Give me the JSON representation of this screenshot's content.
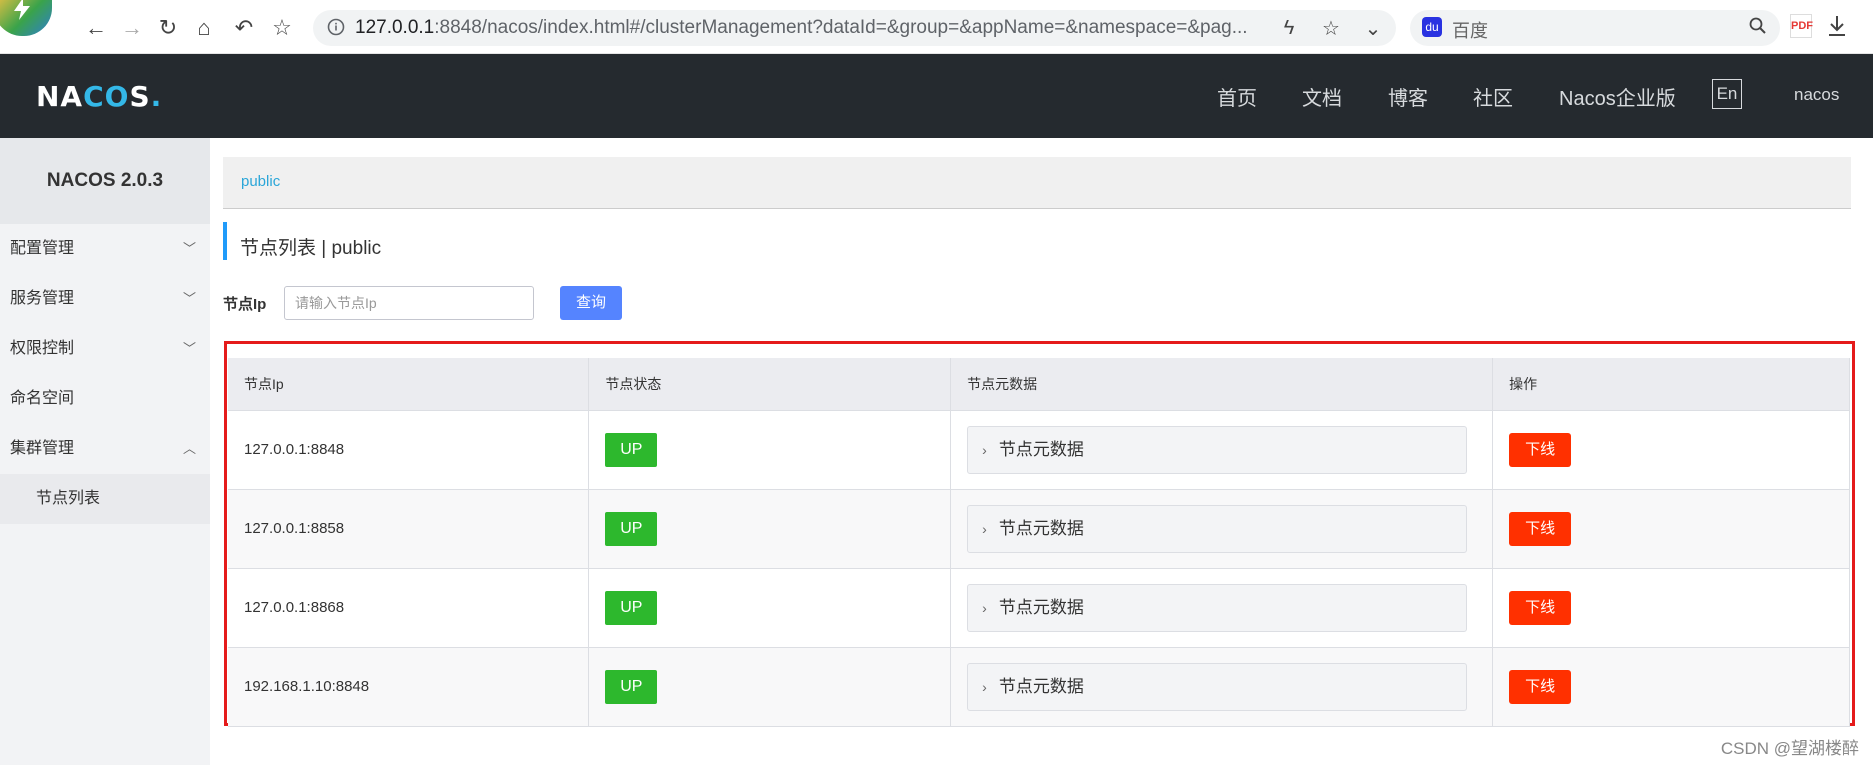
{
  "browser": {
    "url_host": "127.0.0.1",
    "url_rest": ":8848/nacos/index.html#/clusterManagement?dataId=&group=&appName=&namespace=&pag...",
    "search_placeholder": "百度"
  },
  "header": {
    "logo": "NACOS.",
    "nav": [
      "首页",
      "文档",
      "博客",
      "社区",
      "Nacos企业版"
    ],
    "lang": "En",
    "user": "nacos"
  },
  "sidebar": {
    "version": "NACOS 2.0.3",
    "items": [
      {
        "label": "配置管理",
        "expanded": false
      },
      {
        "label": "服务管理",
        "expanded": false
      },
      {
        "label": "权限控制",
        "expanded": false
      },
      {
        "label": "命名空间"
      },
      {
        "label": "集群管理",
        "expanded": true
      }
    ],
    "sub_items": [
      "节点列表"
    ]
  },
  "main": {
    "namespace": "public",
    "title": "节点列表 | public",
    "filter_label": "节点Ip",
    "filter_placeholder": "请输入节点Ip",
    "query_label": "查询",
    "columns": [
      "节点Ip",
      "节点状态",
      "节点元数据",
      "操作"
    ],
    "rows": [
      {
        "ip": "127.0.0.1:8848",
        "state": "UP",
        "meta": "节点元数据",
        "action": "下线"
      },
      {
        "ip": "127.0.0.1:8858",
        "state": "UP",
        "meta": "节点元数据",
        "action": "下线"
      },
      {
        "ip": "127.0.0.1:8868",
        "state": "UP",
        "meta": "节点元数据",
        "action": "下线"
      },
      {
        "ip": "192.168.1.10:8848",
        "state": "UP",
        "meta": "节点元数据",
        "action": "下线"
      }
    ]
  },
  "watermark": "CSDN @望湖楼醉",
  "colors": {
    "header_bg": "#252a2f",
    "up": "#2db82d",
    "offline": "#ff3000",
    "query": "#5584ff",
    "highlight_frame": "#e51b1b"
  }
}
